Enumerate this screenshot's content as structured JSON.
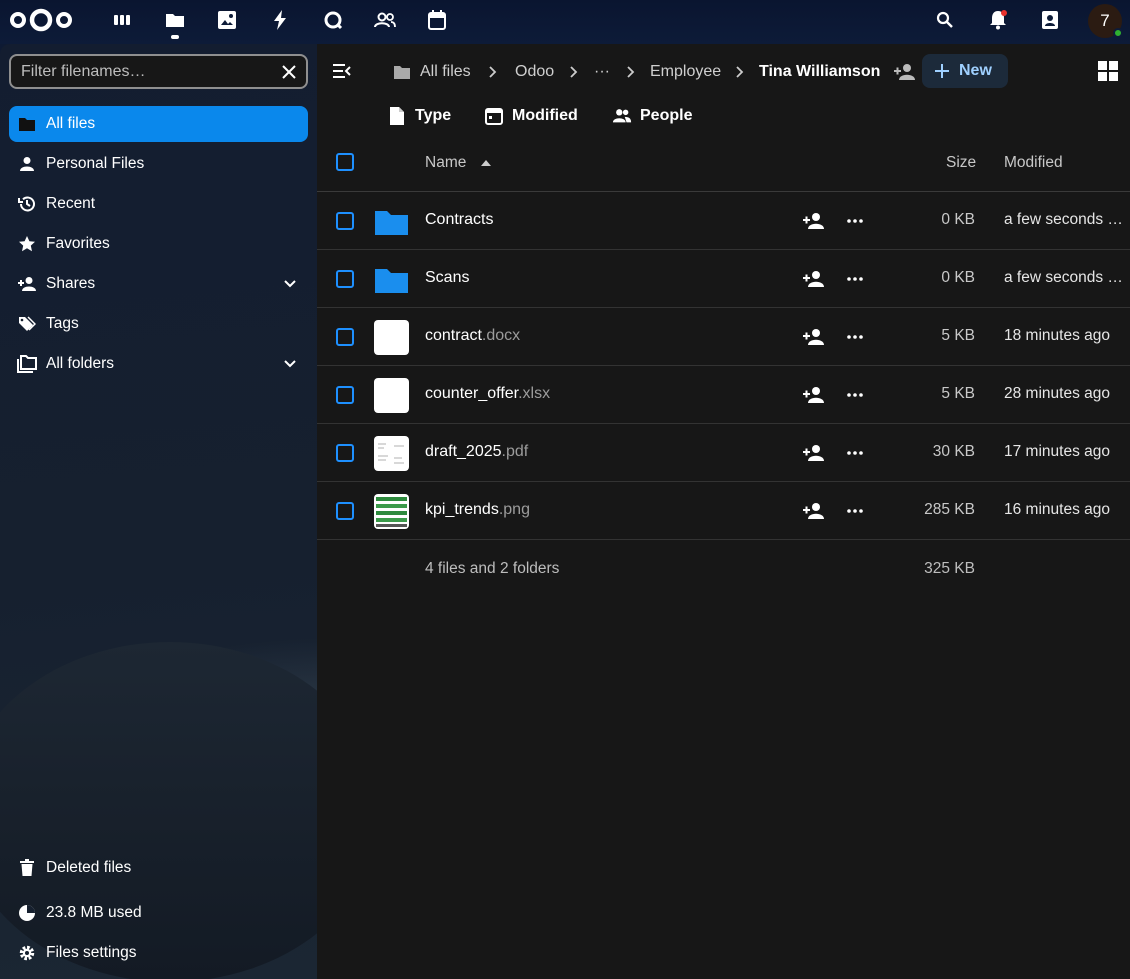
{
  "topbar": {
    "apps": [
      {
        "name": "dashboard-icon"
      },
      {
        "name": "files-icon"
      },
      {
        "name": "photos-icon"
      },
      {
        "name": "activity-icon"
      },
      {
        "name": "talk-icon"
      },
      {
        "name": "contacts-icon"
      },
      {
        "name": "calendar-icon"
      }
    ],
    "avatar_initial": "7"
  },
  "sidebar": {
    "filter_placeholder": "Filter filenames…",
    "items": [
      {
        "label": "All files",
        "icon": "folder-icon",
        "active": true
      },
      {
        "label": "Personal Files",
        "icon": "person-icon"
      },
      {
        "label": "Recent",
        "icon": "history-icon"
      },
      {
        "label": "Favorites",
        "icon": "star-icon"
      },
      {
        "label": "Shares",
        "icon": "share-icon",
        "expandable": true
      },
      {
        "label": "Tags",
        "icon": "tag-icon"
      },
      {
        "label": "All folders",
        "icon": "folders-icon",
        "expandable": true
      }
    ],
    "footer": {
      "deleted": "Deleted files",
      "usage": "23.8 MB used",
      "settings": "Files settings"
    }
  },
  "breadcrumb": {
    "all_files": "All files",
    "odoo": "Odoo",
    "ellipsis": "···",
    "employee": "Employee",
    "current": "Tina Williamson"
  },
  "new_button": "New",
  "filters": {
    "type": "Type",
    "modified": "Modified",
    "people": "People"
  },
  "table": {
    "headers": {
      "name": "Name",
      "size": "Size",
      "modified": "Modified"
    },
    "rows": [
      {
        "base": "Contracts",
        "ext": "",
        "kind": "folder",
        "size": "0 KB",
        "modified": "a few seconds ago"
      },
      {
        "base": "Scans",
        "ext": "",
        "kind": "folder",
        "size": "0 KB",
        "modified": "a few seconds ago"
      },
      {
        "base": "contract",
        "ext": ".docx",
        "kind": "doc",
        "size": "5 KB",
        "modified": "18 minutes ago"
      },
      {
        "base": "counter_offer",
        "ext": ".xlsx",
        "kind": "doc",
        "size": "5 KB",
        "modified": "28 minutes ago"
      },
      {
        "base": "draft_2025",
        "ext": ".pdf",
        "kind": "pdf",
        "size": "30 KB",
        "modified": "17 minutes ago"
      },
      {
        "base": "kpi_trends",
        "ext": ".png",
        "kind": "image",
        "size": "285 KB",
        "modified": "16 minutes ago"
      }
    ],
    "summary": {
      "count": "4 files and 2 folders",
      "total": "325 KB"
    }
  }
}
